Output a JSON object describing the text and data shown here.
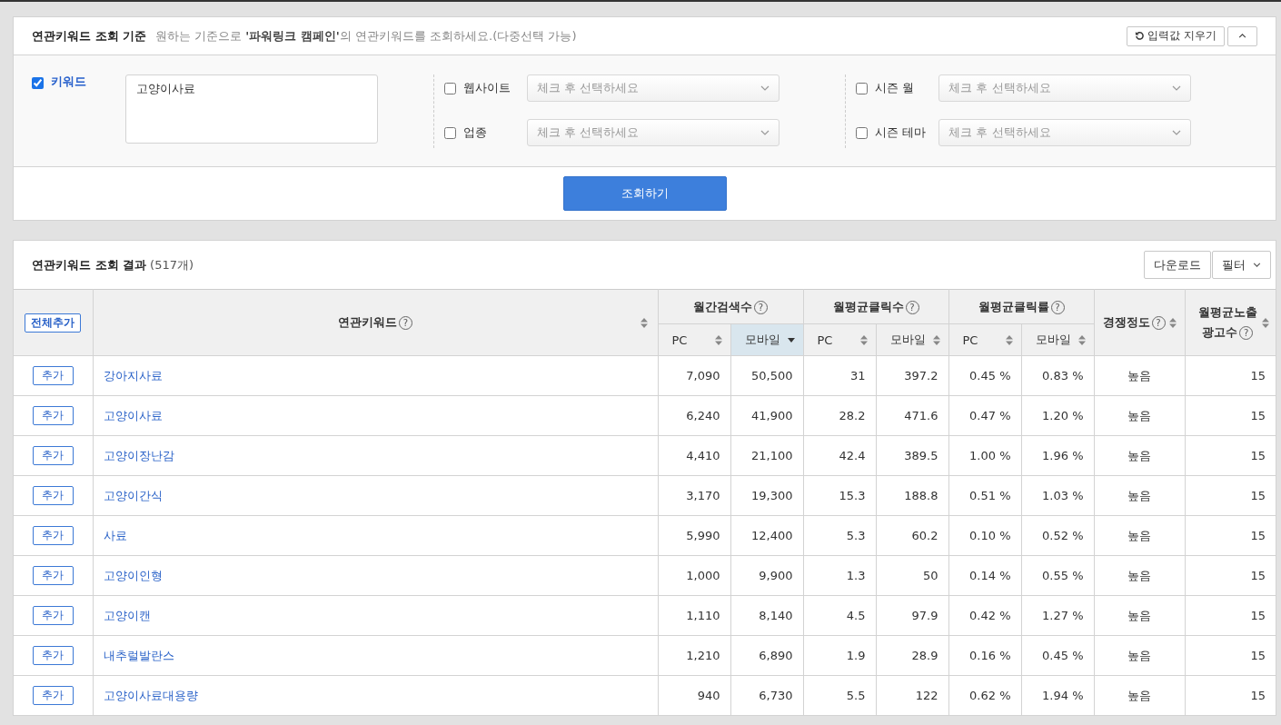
{
  "criteria": {
    "title": "연관키워드 조회 기준",
    "description": "원하는 기준으로 **'파워링크 캠페인'**의 연관키워드를 조회하세요.(다중선택 가능)",
    "reset_button": "입력값 지우기",
    "keyword": {
      "label": "키워드",
      "checked": true,
      "value": "고양이사료"
    },
    "filters": [
      {
        "label": "웹사이트",
        "checked": false,
        "placeholder": "체크 후 선택하세요"
      },
      {
        "label": "업종",
        "checked": false,
        "placeholder": "체크 후 선택하세요"
      },
      {
        "label": "시즌 월",
        "checked": false,
        "placeholder": "체크 후 선택하세요"
      },
      {
        "label": "시즌 테마",
        "checked": false,
        "placeholder": "체크 후 선택하세요"
      }
    ],
    "search_button": "조회하기"
  },
  "results": {
    "title": "연관키워드 조회 결과",
    "count": "(517개)",
    "download_button": "다운로드",
    "filter_button": "필터",
    "add_all_button": "전체추가",
    "columns": [
      {
        "label": "연관키워드",
        "help": "?",
        "sorted": false
      },
      {
        "label": "월간검색수",
        "help": "?",
        "subcolumns": [
          {
            "label": "PC",
            "sorted": false,
            "selected": false
          },
          {
            "label": "모바일",
            "sorted": true,
            "selected": true
          }
        ]
      },
      {
        "label": "월평균클릭수",
        "help": "?",
        "subcolumns": [
          {
            "label": "PC",
            "sorted": false,
            "selected": false
          },
          {
            "label": "모바일",
            "sorted": false,
            "selected": false
          }
        ]
      },
      {
        "label": "월평균클릭률",
        "help": "?",
        "subcolumns": [
          {
            "label": "PC",
            "sorted": false,
            "selected": false
          },
          {
            "label": "모바일",
            "sorted": false,
            "selected": false
          }
        ]
      },
      {
        "label": "경쟁정도",
        "help": "?",
        "sorted": false
      },
      {
        "lines": [
          "월평균노출",
          "광고수"
        ],
        "help": "?",
        "sorted": false
      }
    ],
    "rows": [
      {
        "add_button": "추가",
        "keyword": "강아지사료",
        "values": [
          "7,090",
          "50,500",
          "31",
          "397.2",
          "0.45 %",
          "0.83 %"
        ],
        "competition": "높음",
        "ads": "15"
      },
      {
        "add_button": "추가",
        "keyword": "고양이사료",
        "values": [
          "6,240",
          "41,900",
          "28.2",
          "471.6",
          "0.47 %",
          "1.20 %"
        ],
        "competition": "높음",
        "ads": "15"
      },
      {
        "add_button": "추가",
        "keyword": "고양이장난감",
        "values": [
          "4,410",
          "21,100",
          "42.4",
          "389.5",
          "1.00 %",
          "1.96 %"
        ],
        "competition": "높음",
        "ads": "15"
      },
      {
        "add_button": "추가",
        "keyword": "고양이간식",
        "values": [
          "3,170",
          "19,300",
          "15.3",
          "188.8",
          "0.51 %",
          "1.03 %"
        ],
        "competition": "높음",
        "ads": "15"
      },
      {
        "add_button": "추가",
        "keyword": "사료",
        "values": [
          "5,990",
          "12,400",
          "5.3",
          "60.2",
          "0.10 %",
          "0.52 %"
        ],
        "competition": "높음",
        "ads": "15"
      },
      {
        "add_button": "추가",
        "keyword": "고양이인형",
        "values": [
          "1,000",
          "9,900",
          "1.3",
          "50",
          "0.14 %",
          "0.55 %"
        ],
        "competition": "높음",
        "ads": "15"
      },
      {
        "add_button": "추가",
        "keyword": "고양이캔",
        "values": [
          "1,110",
          "8,140",
          "4.5",
          "97.9",
          "0.42 %",
          "1.27 %"
        ],
        "competition": "높음",
        "ads": "15"
      },
      {
        "add_button": "추가",
        "keyword": "내추럴발란스",
        "values": [
          "1,210",
          "6,890",
          "1.9",
          "28.9",
          "0.16 %",
          "0.45 %"
        ],
        "competition": "높음",
        "ads": "15"
      },
      {
        "add_button": "추가",
        "keyword": "고양이사료대용량",
        "values": [
          "940",
          "6,730",
          "5.5",
          "122",
          "0.62 %",
          "1.94 %"
        ],
        "competition": "높음",
        "ads": "15"
      }
    ]
  }
}
